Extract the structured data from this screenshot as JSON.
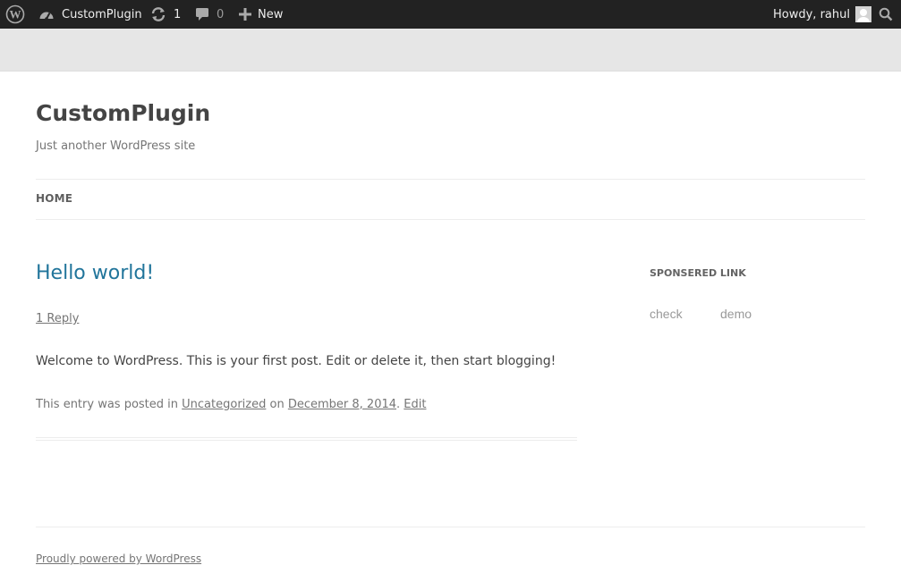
{
  "admin_bar": {
    "site_name": "CustomPlugin",
    "updates_count": "1",
    "comments_count": "0",
    "new_label": "New",
    "greeting": "Howdy, rahul"
  },
  "site": {
    "title": "CustomPlugin",
    "description": "Just another WordPress site"
  },
  "nav": {
    "home": "HOME"
  },
  "post": {
    "title": "Hello world!",
    "reply_link": "1 Reply",
    "body": "Welcome to WordPress. This is your first post. Edit or delete it, then start blogging!",
    "meta_prefix": "This entry was posted in",
    "category": "Uncategorized",
    "meta_on": "on",
    "date": "December 8, 2014",
    "edit": "Edit"
  },
  "sidebar": {
    "widget_title": "SPONSERED LINK",
    "links": [
      "check",
      "demo"
    ]
  },
  "footer": {
    "powered": "Proudly powered by WordPress"
  },
  "colors": {
    "admin_bar_bg": "#222222",
    "link": "#21759b",
    "text": "#444444",
    "muted": "#757575"
  }
}
